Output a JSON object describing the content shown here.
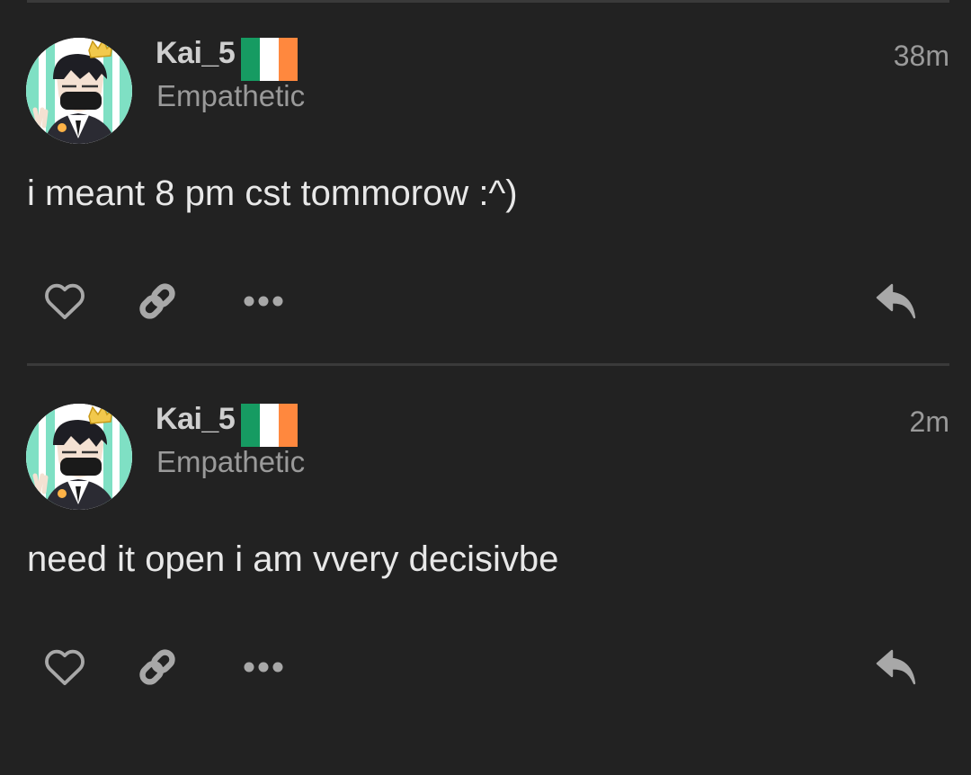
{
  "posts": [
    {
      "username": "Kai_5",
      "user_title": "Empathetic",
      "timestamp": "38m",
      "body": "i meant 8 pm cst tommorow :^)",
      "flag": "ireland-flag"
    },
    {
      "username": "Kai_5",
      "user_title": "Empathetic",
      "timestamp": "2m",
      "body": "need it open i am vvery decisivbe",
      "flag": "ireland-flag"
    }
  ],
  "actions": {
    "like": "heart-icon",
    "copy_link": "link-icon",
    "more": "more-icon",
    "reply": "reply-icon"
  },
  "colors": {
    "background": "#222222",
    "text_primary": "#e8e8e8",
    "text_muted": "#9a9a9a",
    "icon": "#a8a8a8",
    "divider": "#3a3a3a",
    "flag_green": "#169b62",
    "flag_white": "#ffffff",
    "flag_orange": "#ff883e"
  }
}
